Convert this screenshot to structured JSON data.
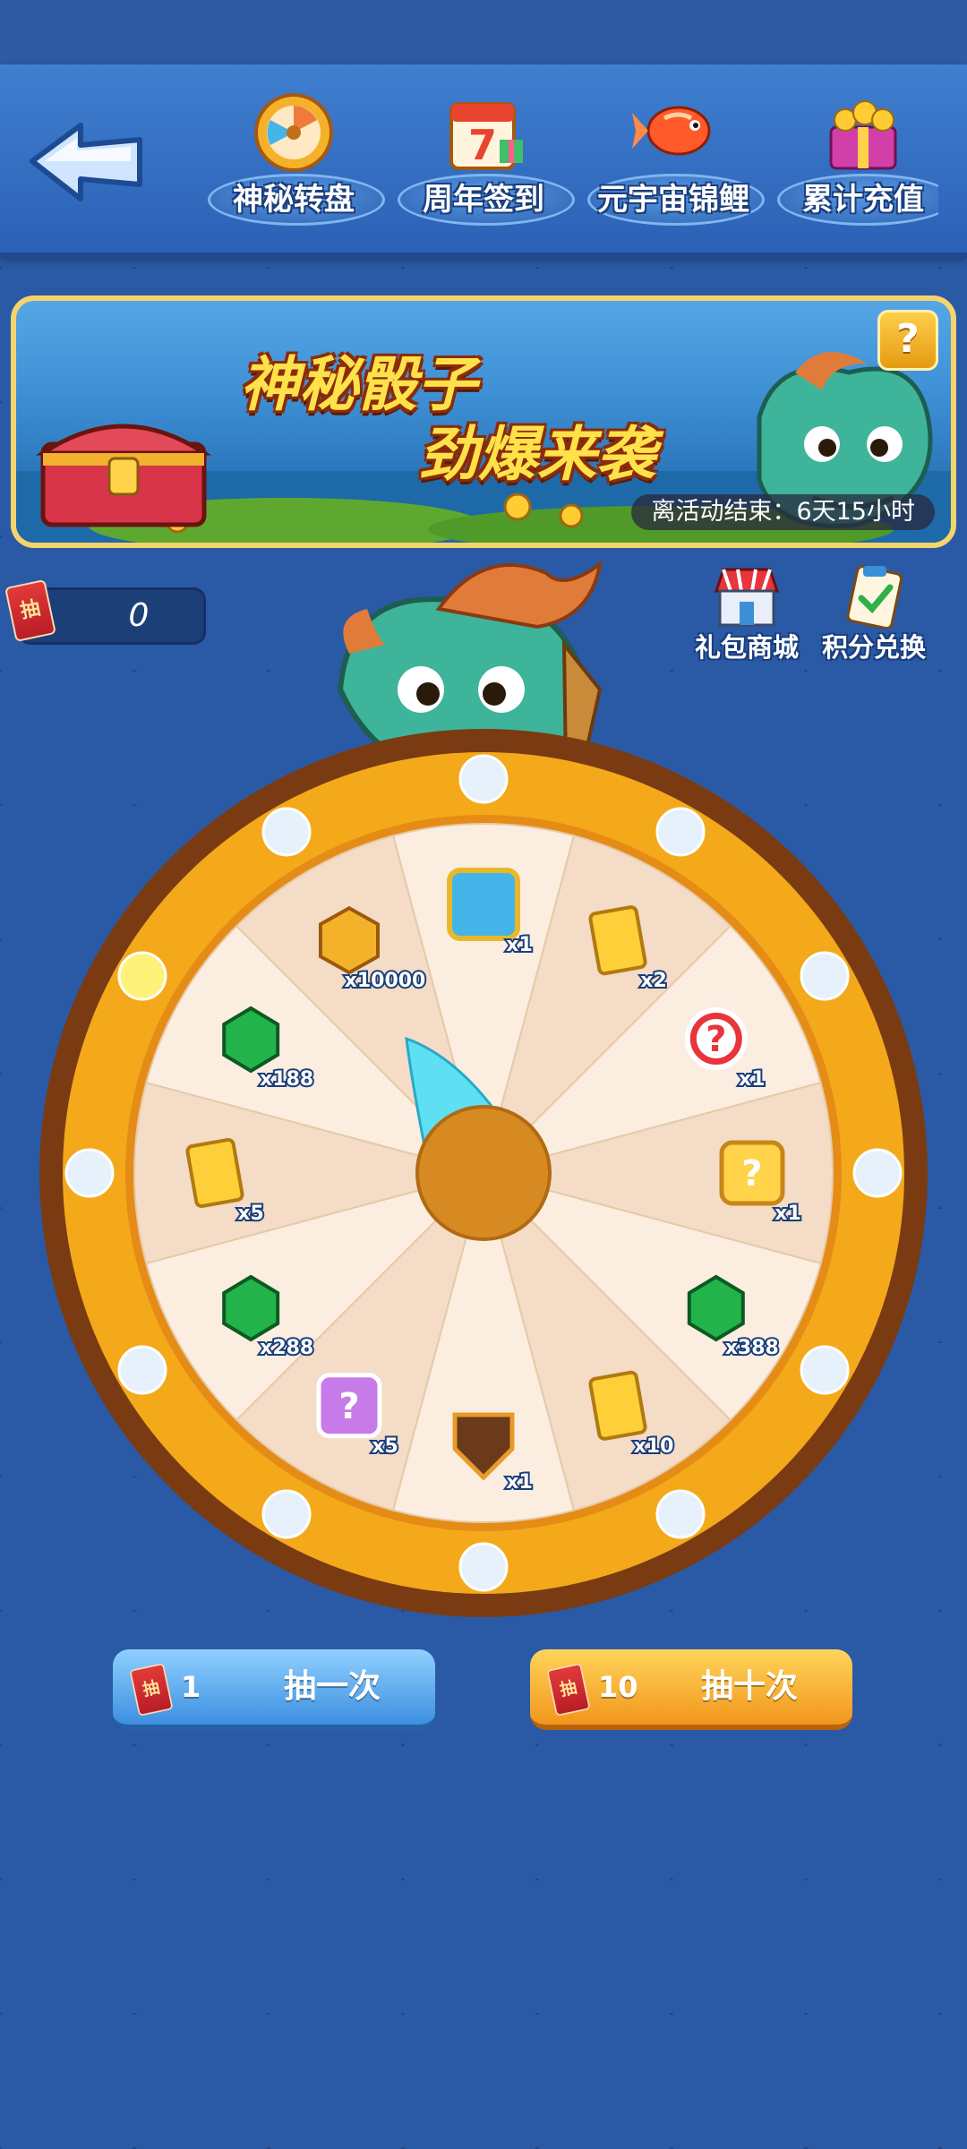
{
  "nav": {
    "back_icon": "back-arrow-icon",
    "tabs": [
      {
        "label": "神秘转盘",
        "icon": "roulette-icon"
      },
      {
        "label": "周年签到",
        "icon": "calendar-icon"
      },
      {
        "label": "元宇宙锦鲤",
        "icon": "koi-fish-icon"
      },
      {
        "label": "累计充值",
        "icon": "treasure-gift-icon"
      }
    ]
  },
  "banner": {
    "title_line1": "神秘骰子",
    "title_line2": "劲爆来袭",
    "help_label": "?",
    "countdown": "离活动结束：6天15小时"
  },
  "draw_counter": {
    "coupon_label": "抽",
    "value": "0"
  },
  "side_buttons": [
    {
      "label": "礼包商城",
      "icon": "shop-icon"
    },
    {
      "label": "积分兑换",
      "icon": "points-exchange-icon"
    }
  ],
  "wheel": {
    "prizes": [
      {
        "name": "dragon-card",
        "qty": "x1"
      },
      {
        "name": "dice-card",
        "qty": "x2"
      },
      {
        "name": "mystery-red",
        "qty": "x1"
      },
      {
        "name": "mystery-gold",
        "qty": "x1"
      },
      {
        "name": "emerald",
        "qty": "x388"
      },
      {
        "name": "dice-card",
        "qty": "x10"
      },
      {
        "name": "fire-shield",
        "qty": "x1"
      },
      {
        "name": "mystery-purple",
        "qty": "x5"
      },
      {
        "name": "emerald",
        "qty": "x288"
      },
      {
        "name": "dice-card",
        "qty": "x5"
      },
      {
        "name": "emerald",
        "qty": "x188"
      },
      {
        "name": "gold-coin",
        "qty": "x10000"
      }
    ]
  },
  "actions": {
    "single": {
      "coupon_label": "抽",
      "cost": "1",
      "label": "抽一次"
    },
    "ten": {
      "coupon_label": "抽",
      "cost": "10",
      "label": "抽十次"
    }
  },
  "colors": {
    "wheel_gold": "#f4a91a",
    "wheel_rim": "#7a3b12",
    "segment_light": "#fbeee0",
    "segment_alt": "#f4dcc6",
    "hub": "#d88a22",
    "pointer": "#5fe0f2"
  }
}
